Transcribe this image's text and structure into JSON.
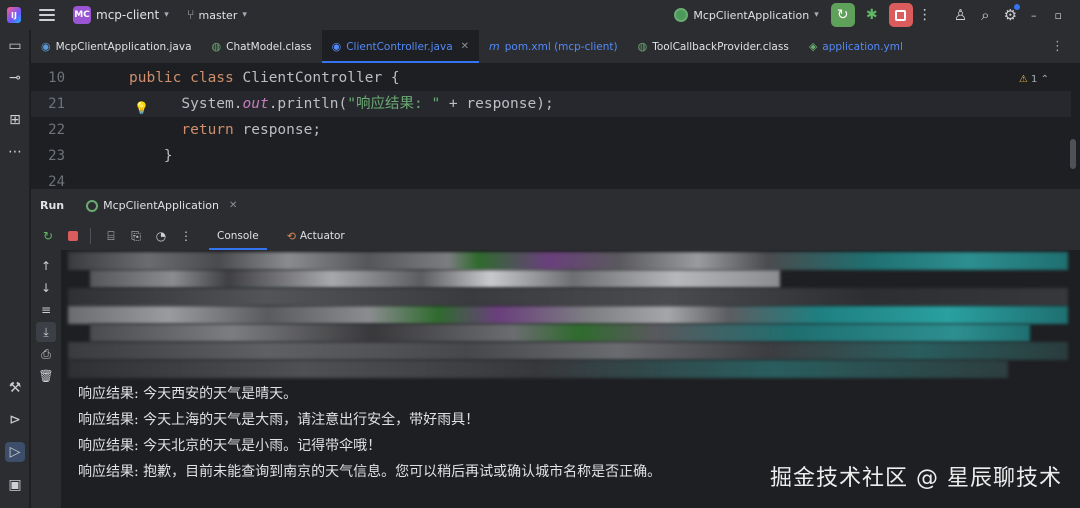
{
  "titlebar": {
    "project_badge": "MC",
    "project_name": "mcp-client",
    "branch": "master",
    "run_config": "McpClientApplication"
  },
  "tabs": [
    {
      "label": "McpClientApplication.java",
      "icon": "java-class-icon"
    },
    {
      "label": "ChatModel.class",
      "icon": "interface-icon"
    },
    {
      "label": "ClientController.java",
      "icon": "java-class-icon",
      "active": true
    },
    {
      "label": "pom.xml (mcp-client)",
      "icon": "maven-icon"
    },
    {
      "label": "ToolCallbackProvider.class",
      "icon": "interface-icon"
    },
    {
      "label": "application.yml",
      "icon": "yaml-icon"
    }
  ],
  "editor": {
    "warning_count": "1",
    "lines": [
      {
        "num": "10",
        "kw": "public class ",
        "rest": "ClientController {"
      },
      {
        "num": "21",
        "pre": "      System.",
        "field": "out",
        "mid": ".println(",
        "str": "\"响应结果: \"",
        "post": " + response);"
      },
      {
        "num": "22",
        "kw": "      return ",
        "rest": "response;"
      },
      {
        "num": "23",
        "rest": "    }"
      },
      {
        "num": "24"
      }
    ]
  },
  "run_panel": {
    "label": "Run",
    "tab": "McpClientApplication",
    "console_tab": "Console",
    "actuator_tab": "Actuator"
  },
  "console": {
    "lines": [
      "响应结果: 今天西安的天气是晴天。",
      "响应结果: 今天上海的天气是大雨，请注意出行安全，带好雨具！",
      "响应结果: 今天北京的天气是小雨。记得带伞哦！",
      "响应结果: 抱歉，目前未能查询到南京的天气信息。您可以稍后再试或确认城市名称是否正确。"
    ]
  },
  "watermark": "掘金技术社区 @ 星辰聊技术",
  "colors": {
    "accent": "#3574f0",
    "keyword": "#cf8e6d",
    "string": "#6aab73",
    "field": "#c77dbb",
    "run_green": "#5fa05a",
    "stop_red": "#db5c5c"
  }
}
